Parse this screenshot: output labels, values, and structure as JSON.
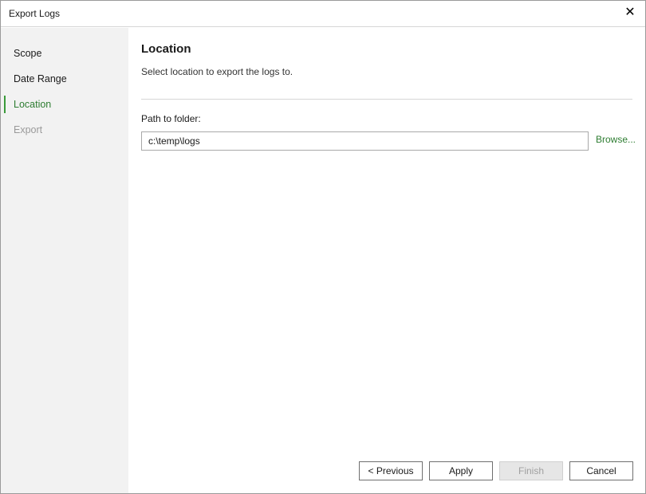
{
  "window": {
    "title": "Export Logs"
  },
  "sidebar": {
    "items": [
      {
        "label": "Scope",
        "state": "normal"
      },
      {
        "label": "Date Range",
        "state": "normal"
      },
      {
        "label": "Location",
        "state": "active"
      },
      {
        "label": "Export",
        "state": "disabled"
      }
    ]
  },
  "main": {
    "title": "Location",
    "description": "Select location to export the logs to.",
    "path_label": "Path to folder:",
    "path_value": "c:\\temp\\logs",
    "browse_label": "Browse..."
  },
  "footer": {
    "previous_label": "< Previous",
    "apply_label": "Apply",
    "finish_label": "Finish",
    "cancel_label": "Cancel"
  },
  "colors": {
    "accent": "#2e7d32",
    "sidebar_bg": "#f2f2f2"
  },
  "icons": {
    "close": "close-icon"
  }
}
